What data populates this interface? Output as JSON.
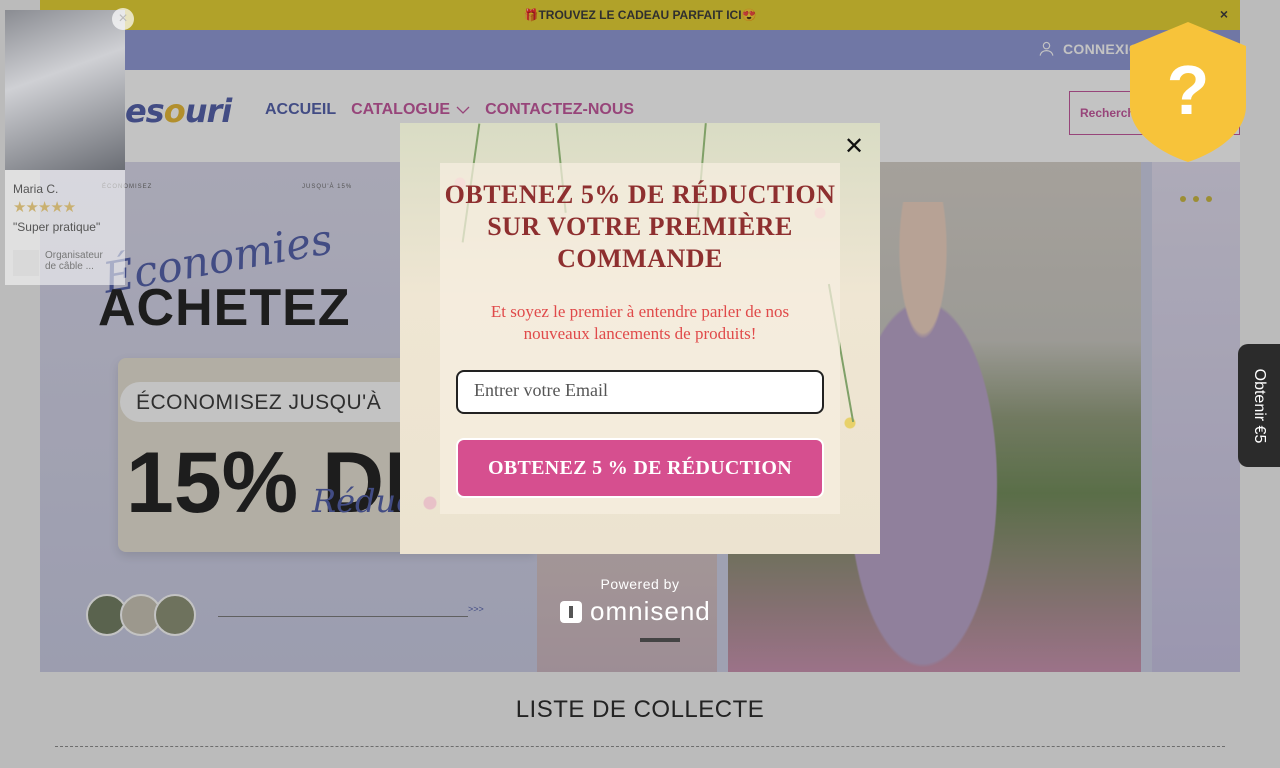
{
  "announcement": {
    "text": "🎁TROUVEZ LE CADEAU PARFAIT ICI😍",
    "close": "×"
  },
  "topbar": {
    "login_label": "CONNEXION"
  },
  "header": {
    "logo": {
      "part1": "Lunes",
      "part2": "o",
      "part3": "uri"
    },
    "nav": [
      {
        "label": "ACCUEIL"
      },
      {
        "label": "CATALOGUE"
      },
      {
        "label": "CONTACTEZ-NOUS"
      }
    ],
    "search_placeholder": "Rechercher"
  },
  "hero": {
    "slide1": {
      "small_left": "ÉCONOMISEZ",
      "small_right": "JUSQU'À 15%",
      "script": "Économies",
      "headline": "ACHETEZ",
      "pill": "ÉCONOMISEZ JUSQU'À",
      "percent": "15% DE",
      "script2": "Réduc",
      "arrows": ">>>"
    }
  },
  "collection": {
    "title": "LISTE DE COLLECTE"
  },
  "review": {
    "name": "Maria C.",
    "stars": "★★★★★",
    "text": "\"Super pratique\"",
    "product": "Organisateur de câble ...",
    "close": "×"
  },
  "popup": {
    "title": "OBTENEZ 5% DE RÉDUCTION SUR VOTRE PREMIÈRE COMMANDE",
    "subtitle": "Et soyez le premier à entendre parler de nos nouveaux lancements de produits!",
    "email_placeholder": "Entrer votre Email",
    "cta_label": "OBTENEZ 5 % DE RÉDUCTION",
    "close": "✕"
  },
  "branding": {
    "powered_by": "Powered by",
    "brand": "omnisend"
  },
  "shield": {
    "symbol": "?"
  },
  "side_tab": {
    "label": "Obtenir €5"
  },
  "colors": {
    "accent_pink": "#d64f8f",
    "accent_blue": "#4d5ba8",
    "announce_yellow": "#e6d12a",
    "title_red": "#8e2f2f"
  }
}
